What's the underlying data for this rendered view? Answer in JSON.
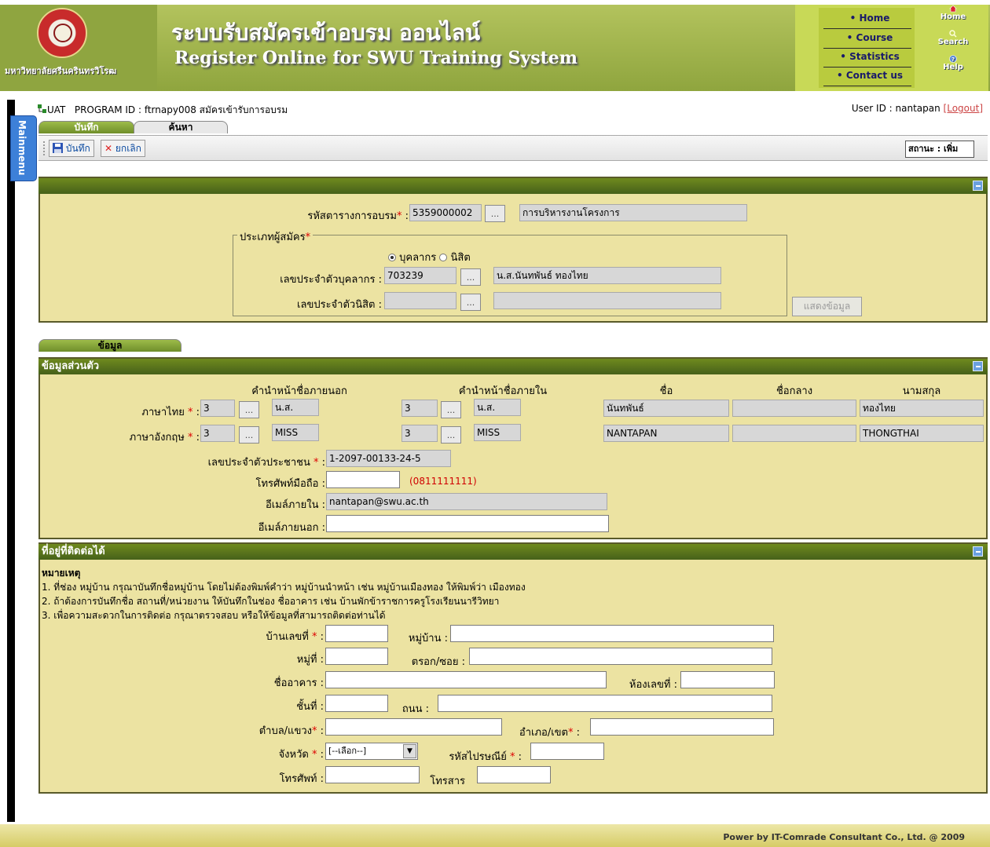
{
  "header": {
    "university_name": "มหาวิทยาลัยศรีนครินทรวิโรฒ",
    "title_th": "ระบบรับสมัครเข้าอบรม ออนไลน์",
    "title_en": "Register Online for SWU Training System",
    "nav": [
      "Home",
      "Course",
      "Statistics",
      "Contact us"
    ],
    "right_links": [
      "Home",
      "Search",
      "Help"
    ]
  },
  "mainmenu": "Mainmenu",
  "program": {
    "env": "UAT",
    "program_id_label": "PROGRAM ID : ftrnapy008 สมัครเข้ารับการอบรม",
    "user_label": "User ID : nantapan",
    "logout": "[Logout]"
  },
  "tabs": [
    "บันทึก",
    "ค้นหา"
  ],
  "toolbar": {
    "save": "บันทึก",
    "cancel": "ยกเลิก",
    "status": "สถานะ : เพิ่ม"
  },
  "course_panel": {
    "schedule_label": "รหัสตารางการอบรม",
    "schedule_code": "5359000002",
    "schedule_name": "การบริหารงานโครงการ",
    "applicant_type_label": "ประเภทผู้สมัคร",
    "radio_staff": "บุคลากร",
    "radio_student": "นิสิต",
    "staff_id_label": "เลขประจำตัวบุคลากร :",
    "staff_id": "703239",
    "staff_name": "น.ส.นันทพันธ์  ทองไทย",
    "student_id_label": "เลขประจำตัวนิสิต :",
    "student_id": "",
    "student_name": "",
    "show_button": "แสดงข้อมูล"
  },
  "info_tab": "ข้อมูล",
  "personal": {
    "title": "ข้อมูลส่วนตัว",
    "col_outer_prefix": "คำนำหน้าชื่อภายนอก",
    "col_inner_prefix": "คำนำหน้าชื่อภายใน",
    "col_first": "ชื่อ",
    "col_middle": "ชื่อกลาง",
    "col_last": "นามสกุล",
    "thai_label": "ภาษาไทย",
    "eng_label": "ภาษาอังกฤษ",
    "thai": {
      "outer_code": "3",
      "outer_prefix": "น.ส.",
      "inner_code": "3",
      "inner_prefix": "น.ส.",
      "first": "นันทพันธ์",
      "middle": "",
      "last": "ทองไทย"
    },
    "eng": {
      "outer_code": "3",
      "outer_prefix": "MISS",
      "inner_code": "3",
      "inner_prefix": "MISS",
      "first": "NANTAPAN",
      "middle": "",
      "last": "THONGTHAI"
    },
    "citizen_label": "เลขประจำตัวประชาชน",
    "citizen_id": "1-2097-00133-24-5",
    "mobile_label": "โทรศัพท์มือถือ :",
    "mobile": "",
    "mobile_hint": "(0811111111)",
    "email_in_label": "อีเมล์ภายใน :",
    "email_in": "nantapan@swu.ac.th",
    "email_out_label": "อีเมล์ภายนอก :",
    "email_out": ""
  },
  "address": {
    "title": "ที่อยู่ที่ติดต่อได้",
    "note_title": "หมายเหตุ",
    "notes": [
      "1. ที่ช่อง หมู่บ้าน กรุณาบันทึกชื่อหมู่บ้าน โดยไม่ต้องพิมพ์คำว่า หมู่บ้านนำหน้า เช่น หมู่บ้านเมืองทอง ให้พิมพ์ว่า เมืองทอง",
      "2. ถ้าต้องการบันทึกชื่อ สถานที่/หน่วยงาน ให้บันทึกในช่อง ชื่ออาคาร เช่น บ้านพักข้าราชการครูโรงเรียนนารีวิทยา",
      "3. เพื่อความสะดวกในการติดต่อ กรุณาตรวจสอบ หรือให้ข้อมูลที่สามารถติดต่อท่านได้"
    ],
    "house_no_label": "บ้านเลขที่",
    "village_label": "หมู่บ้าน :",
    "moo_label": "หมู่ที่ :",
    "soi_label": "ตรอก/ซอย :",
    "building_label": "ชื่ออาคาร :",
    "room_label": "ห้องเลขที่ :",
    "floor_label": "ชั้นที่ :",
    "road_label": "ถนน :",
    "subdistrict_label": "ตำบล/แขวง",
    "district_label": "อำเภอ/เขต",
    "province_label": "จังหวัด",
    "province_value": "[--เลือก--]",
    "postcode_label": "รหัสไปรษณีย์",
    "phone_label": "โทรศัพท์ :",
    "fax_label": "โทรสาร"
  },
  "footer": "Power by IT-Comrade Consultant Co., Ltd. @ 2009"
}
